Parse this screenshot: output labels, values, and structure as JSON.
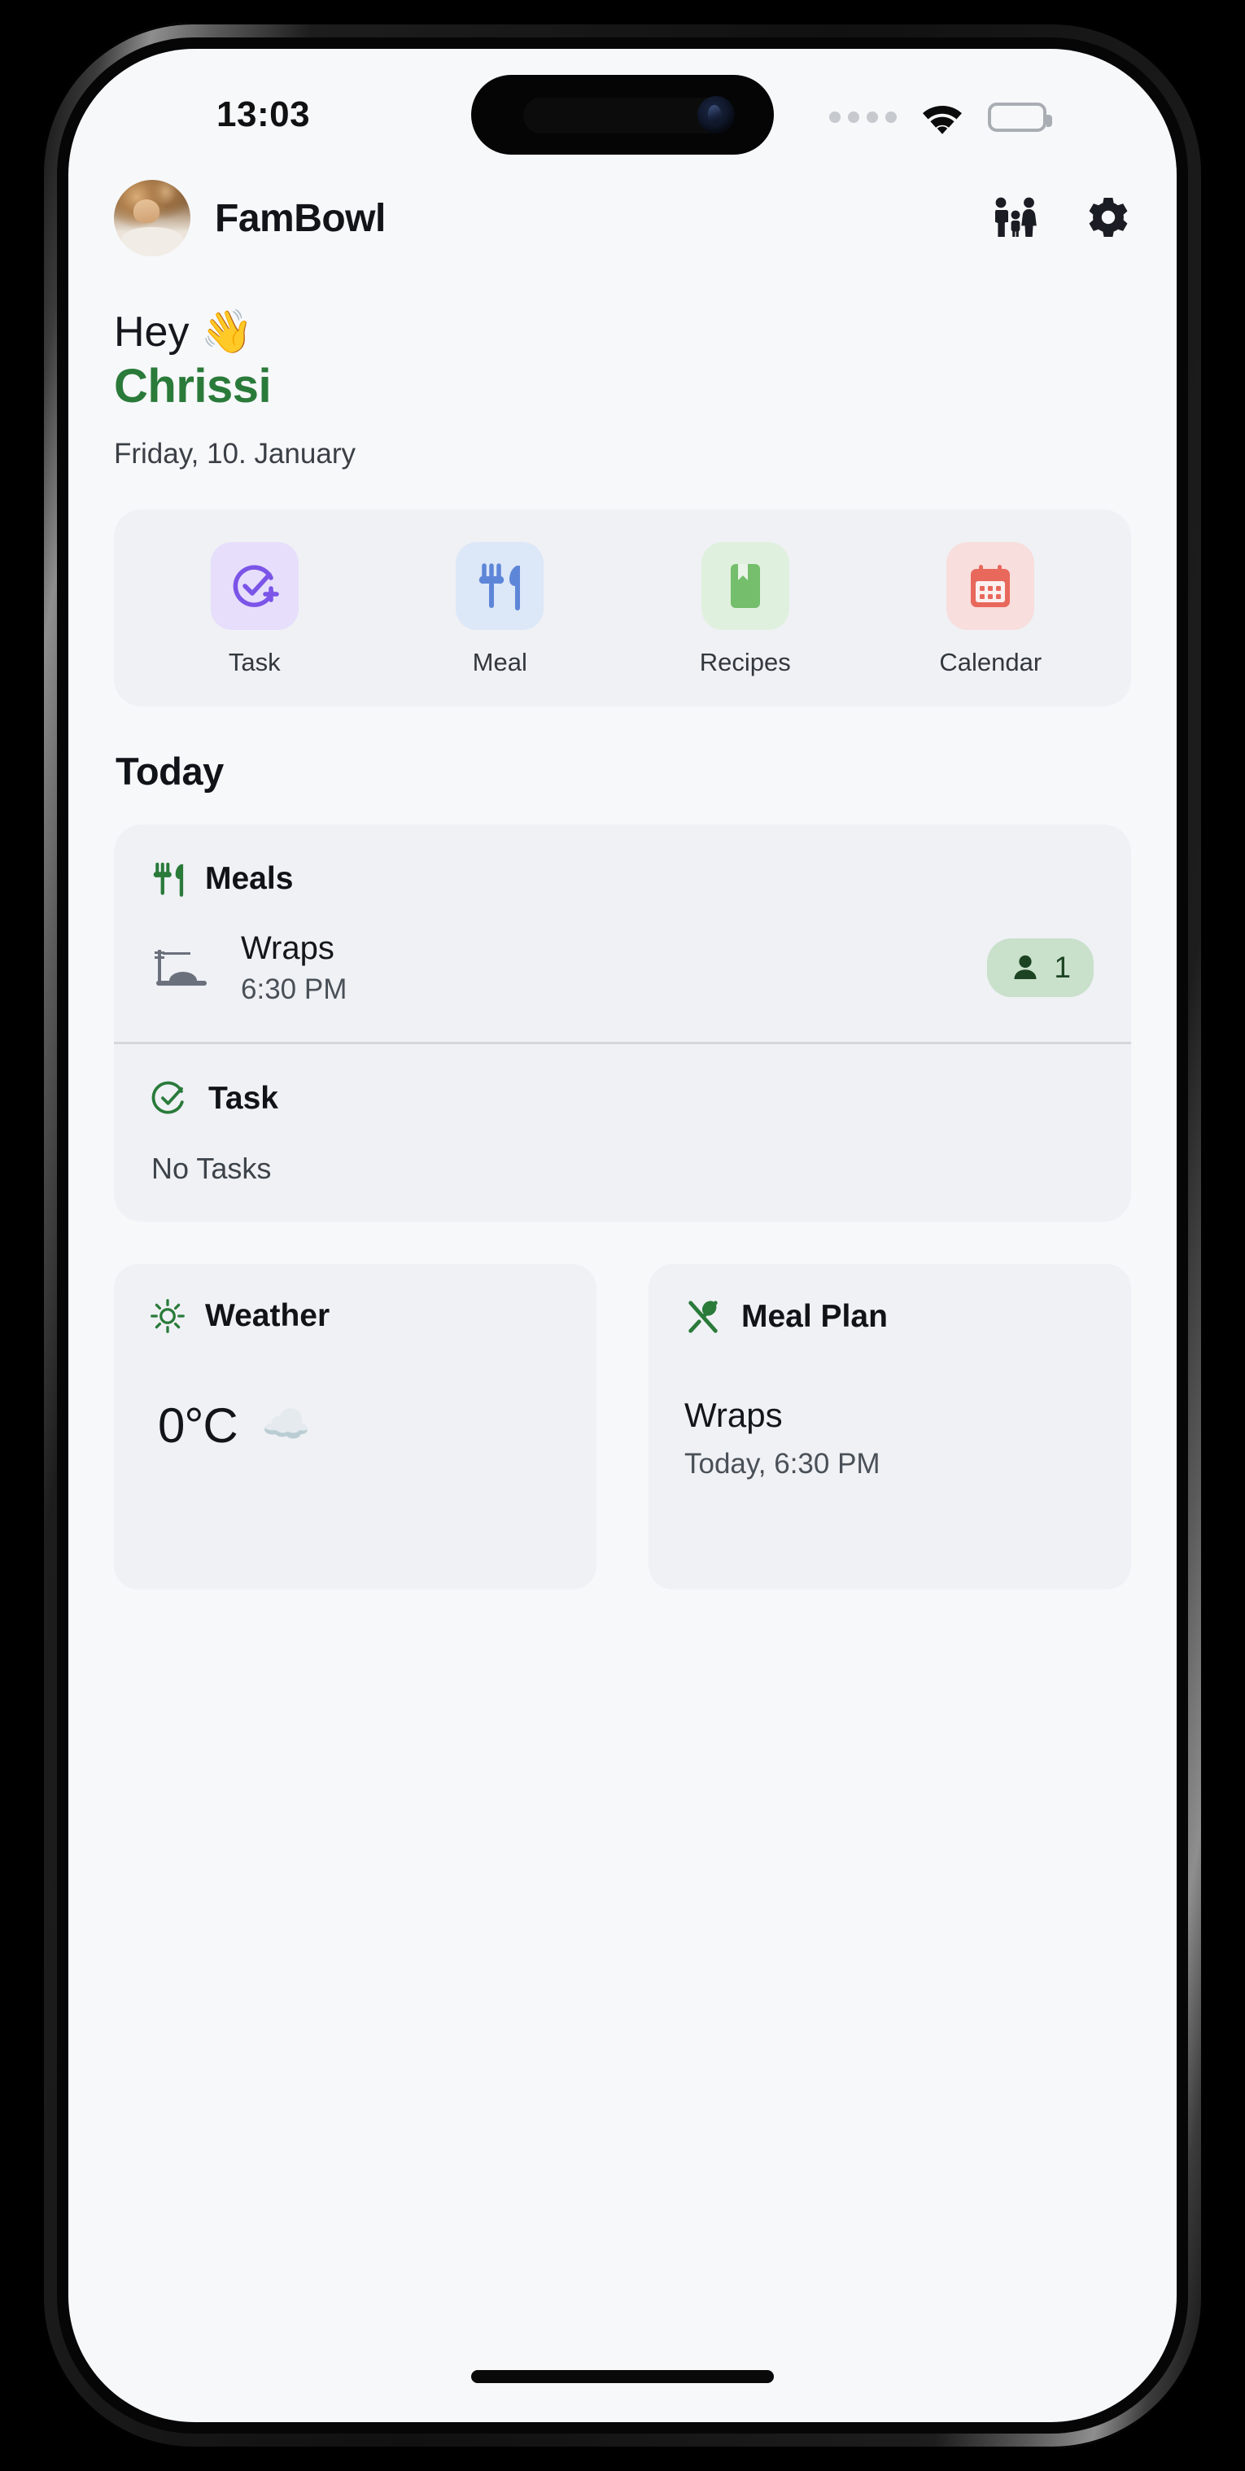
{
  "status_bar": {
    "time": "13:03",
    "signal_dots": 4,
    "wifi_icon": "wifi-icon",
    "battery_icon": "battery-full-icon"
  },
  "header": {
    "avatar": "user-avatar",
    "title": "FamBowl",
    "family_icon": "family-icon",
    "settings_icon": "gear-icon"
  },
  "greeting": {
    "line1": "Hey 👋",
    "name": "Chrissi",
    "date": "Friday, 10. January"
  },
  "quick_actions": [
    {
      "label": "Task",
      "icon": "task-add-icon",
      "icon_color": "#7B54E8",
      "tile_color": "#E6DEFB"
    },
    {
      "label": "Meal",
      "icon": "cutlery-icon",
      "icon_color": "#5E86D8",
      "tile_color": "#DCE7F7"
    },
    {
      "label": "Recipes",
      "icon": "recipe-book-icon",
      "icon_color": "#74BE6C",
      "tile_color": "#E0F0DE"
    },
    {
      "label": "Calendar",
      "icon": "calendar-icon",
      "icon_color": "#E8685C",
      "tile_color": "#F8DEDC"
    }
  ],
  "today": {
    "section_title": "Today",
    "meals": {
      "title": "Meals",
      "icon": "cutlery-icon",
      "items": [
        {
          "name": "Wraps",
          "time": "6:30 PM",
          "thumb_icon": "dinner-dish-icon",
          "people_count": "1",
          "people_icon": "person-icon"
        }
      ]
    },
    "task": {
      "title": "Task",
      "icon": "check-circle-icon",
      "empty_text": "No Tasks"
    }
  },
  "weather": {
    "title": "Weather",
    "icon": "sun-icon",
    "temperature": "0°C",
    "condition_emoji": "☁️"
  },
  "meal_plan": {
    "title": "Meal Plan",
    "icon": "crossed-utensils-icon",
    "name": "Wraps",
    "when": "Today, 6:30 PM"
  },
  "colors": {
    "accent_green": "#2A7A3A",
    "page_bg": "#F7F8FA",
    "card_bg": "#EFF1F5",
    "badge_bg": "#C9E0CB"
  }
}
